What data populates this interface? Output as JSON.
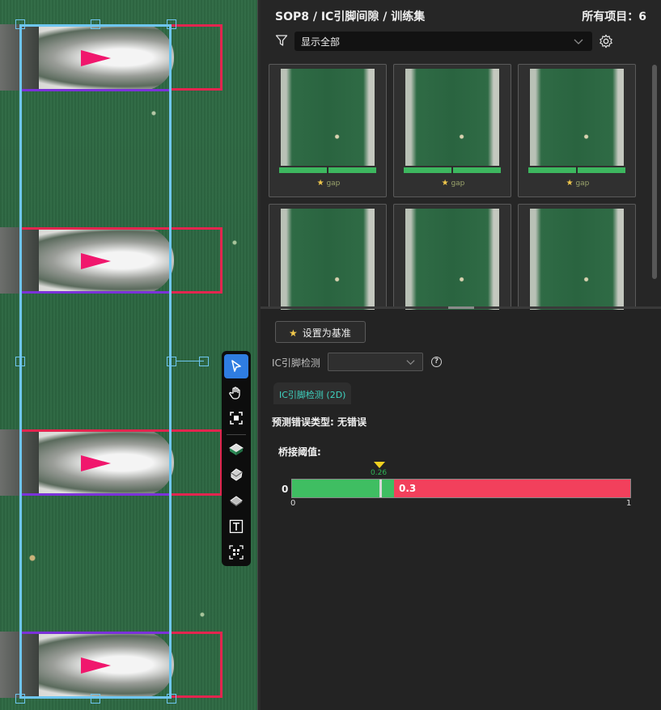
{
  "header": {
    "breadcrumb": "SOP8 / IC引脚间隙 / 训练集",
    "count_label": "所有项目：6"
  },
  "filter": {
    "selected": "显示全部",
    "icons": {
      "filter": "filter-icon",
      "settings": "gear-icon"
    }
  },
  "gallery": {
    "items": [
      {
        "label": "gap",
        "starred": true
      },
      {
        "label": "gap",
        "starred": true
      },
      {
        "label": "gap",
        "starred": true
      },
      {
        "label": "",
        "starred": false
      },
      {
        "label": "",
        "starred": false
      },
      {
        "label": "",
        "starred": false
      }
    ]
  },
  "detail": {
    "baseline_button": "设置为基准",
    "detect_label": "IC引脚检测",
    "detect_value": "",
    "tab_label": "IC引脚检测 (2D)",
    "prediction": "预测错误类型: 无错误",
    "threshold_title": "桥接阈值:",
    "threshold": {
      "min_label": "0",
      "tick_min": "0",
      "tick_max": "1",
      "marker_value": 0.26,
      "marker_label": "0.26",
      "current_value": 0.3,
      "current_label": "0.3"
    }
  },
  "toolbar": {
    "tools": [
      "select-arrow-icon",
      "hand-pan-icon",
      "fit-view-icon",
      "pad-3d-icon",
      "chip-3d-icon",
      "ic-package-icon",
      "text-icon",
      "qr-code-icon"
    ],
    "active": "select-arrow-icon"
  },
  "colors": {
    "selection": "#6ec6f0",
    "box_red": "#e3254f",
    "line_purple": "#7b32d9",
    "arrow_pink": "#f0176d",
    "threshold_green": "#3fbe62",
    "threshold_red": "#f2405c",
    "accent_blue": "#2f7de1"
  }
}
